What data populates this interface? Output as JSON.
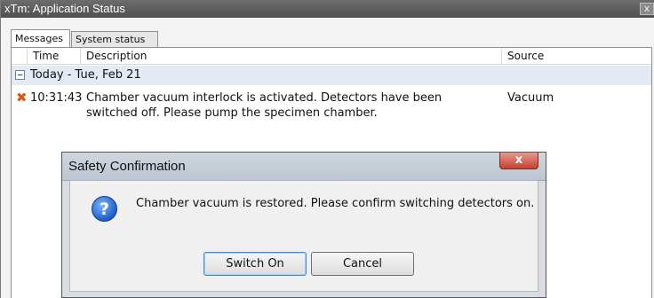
{
  "window": {
    "title": "xTm: Application Status",
    "close_glyph": "x"
  },
  "tabs": [
    {
      "label": "Messages",
      "active": true
    },
    {
      "label": "System status",
      "active": false
    }
  ],
  "table": {
    "columns": [
      "Time",
      "Description",
      "Source"
    ],
    "group_label": "Today - Tue, Feb 21",
    "rows": [
      {
        "icon": "error-x-icon",
        "time": "10:31:43",
        "description_line1": "Chamber vacuum interlock is activated. Detectors have been",
        "description_line2": "switched off. Please pump the specimen chamber.",
        "source": "Vacuum"
      }
    ]
  },
  "dialog": {
    "title": "Safety Confirmation",
    "close_glyph": "x",
    "icon": "question-icon",
    "icon_glyph": "?",
    "message": "Chamber vacuum is restored. Please confirm switching detectors on.",
    "buttons": {
      "confirm": "Switch On",
      "cancel": "Cancel"
    }
  },
  "colors": {
    "error": "#d45a14",
    "group_row": "#e4eaf4",
    "dialog_close": "#c9402f",
    "question_icon": "#1f5ec9"
  }
}
